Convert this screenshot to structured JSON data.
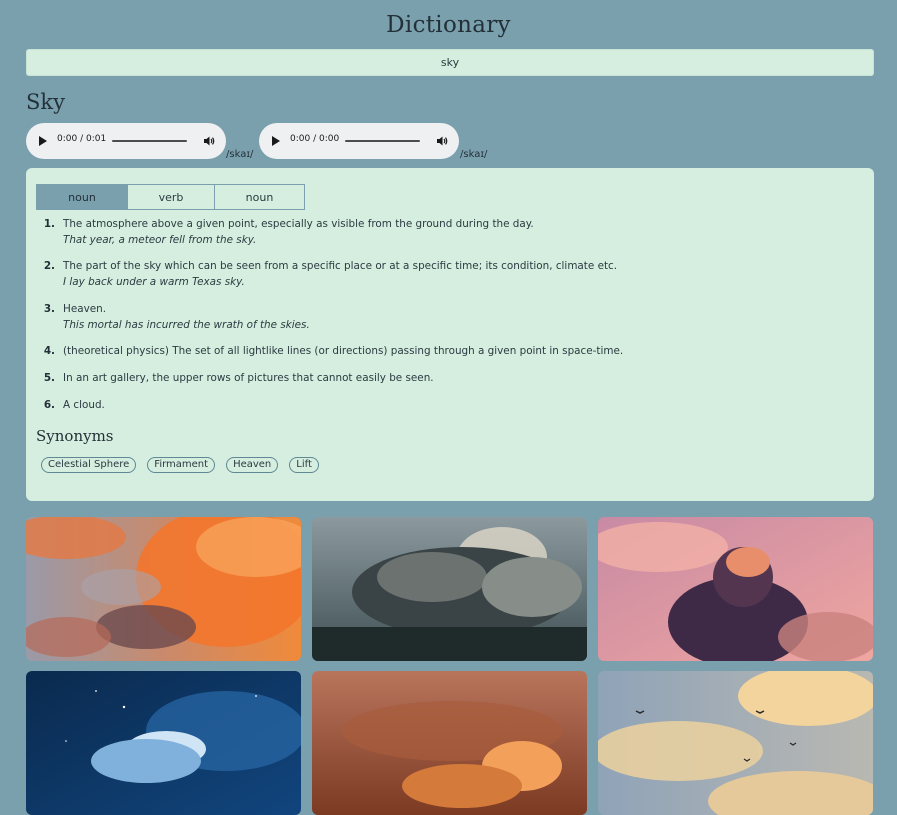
{
  "app": {
    "title": "Dictionary"
  },
  "search": {
    "value": "sky"
  },
  "word": {
    "title": "Sky"
  },
  "pronunciations": [
    {
      "time": "0:00 / 0:01",
      "phonetic": "/skaɪ/"
    },
    {
      "time": "0:00 / 0:00",
      "phonetic": "/skaɪ/"
    }
  ],
  "tabs": [
    {
      "label": "noun",
      "active": true
    },
    {
      "label": "verb",
      "active": false
    },
    {
      "label": "noun",
      "active": false
    }
  ],
  "definitions": [
    {
      "num": "1.",
      "text": "The atmosphere above a given point, especially as visible from the ground during the day.",
      "example": "That year, a meteor fell from the sky."
    },
    {
      "num": "2.",
      "text": "The part of the sky which can be seen from a specific place or at a specific time; its condition, climate etc.",
      "example": "I lay back under a warm Texas sky."
    },
    {
      "num": "3.",
      "text": "Heaven.",
      "example": "This mortal has incurred the wrath of the skies."
    },
    {
      "num": "4.",
      "text": "(theoretical physics) The set of all lightlike lines (or directions) passing through a given point in space-time.",
      "example": ""
    },
    {
      "num": "5.",
      "text": "In an art gallery, the upper rows of pictures that cannot easily be seen.",
      "example": ""
    },
    {
      "num": "6.",
      "text": "A cloud.",
      "example": ""
    }
  ],
  "synonyms": {
    "title": "Synonyms",
    "items": [
      "Celestial Sphere",
      "Firmament",
      "Heaven",
      "Lift"
    ]
  },
  "gallery": [
    {
      "name": "sunset-orange-clouds-image"
    },
    {
      "name": "dark-storm-cloud-image"
    },
    {
      "name": "pink-sky-dark-cloud-image"
    },
    {
      "name": "night-blue-cloud-image"
    },
    {
      "name": "orange-dusk-clouds-image"
    },
    {
      "name": "birds-golden-clouds-image"
    }
  ],
  "colors": {
    "background": "#7aa0ae",
    "panel": "#d6eee0",
    "tab_active": "#7aa0ae",
    "text": "#2b3a40"
  }
}
